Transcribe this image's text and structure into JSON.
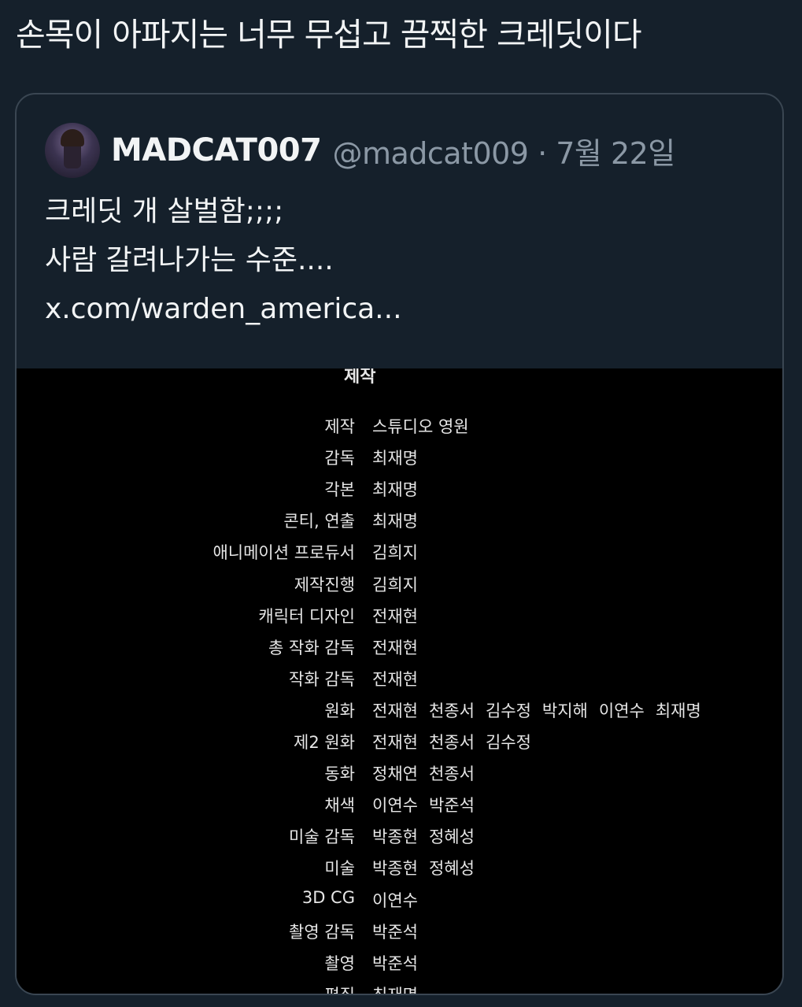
{
  "tweet": {
    "text": "손목이 아파지는 너무 무섭고 끔찍한 크레딧이다"
  },
  "quoted_tweet": {
    "display_name": "MADCAT007",
    "handle_and_date": "@madcat009 · 7월 22일",
    "body_lines": [
      "크레딧 개 살벌함;;;;",
      "사람 갈려나가는 수준....",
      "x.com/warden_america..."
    ]
  },
  "credits": {
    "top_partial": "제작",
    "rows": [
      {
        "role": "제작",
        "names": [
          "스튜디오 영원"
        ]
      },
      {
        "role": "감독",
        "names": [
          "최재명"
        ]
      },
      {
        "role": "각본",
        "names": [
          "최재명"
        ]
      },
      {
        "role": "콘티, 연출",
        "names": [
          "최재명"
        ]
      },
      {
        "role": "애니메이션 프로듀서",
        "names": [
          "김희지"
        ]
      },
      {
        "role": "제작진행",
        "names": [
          "김희지"
        ]
      },
      {
        "role": "캐릭터 디자인",
        "names": [
          "전재현"
        ]
      },
      {
        "role": "총 작화 감독",
        "names": [
          "전재현"
        ]
      },
      {
        "role": "작화 감독",
        "names": [
          "전재현"
        ]
      },
      {
        "role": "원화",
        "names": [
          "전재현",
          "천종서",
          "김수정",
          "박지해",
          "이연수",
          "최재명"
        ]
      },
      {
        "role": "제2 원화",
        "names": [
          "전재현",
          "천종서",
          "김수정"
        ]
      },
      {
        "role": "동화",
        "names": [
          "정채연",
          "천종서"
        ]
      },
      {
        "role": "채색",
        "names": [
          "이연수",
          "박준석"
        ]
      },
      {
        "role": "미술 감독",
        "names": [
          "박종현",
          "정혜성"
        ]
      },
      {
        "role": "미술",
        "names": [
          "박종현",
          "정혜성"
        ]
      },
      {
        "role": "3D CG",
        "names": [
          "이연수"
        ]
      },
      {
        "role": "촬영 감독",
        "names": [
          "박준석"
        ]
      },
      {
        "role": "촬영",
        "names": [
          "박준석"
        ]
      },
      {
        "role": "편집",
        "names": [
          "최재명"
        ]
      }
    ]
  },
  "colors": {
    "background": "#15202b",
    "border": "#3a4652",
    "secondary_text": "#8b98a5",
    "media_background": "#000000"
  }
}
